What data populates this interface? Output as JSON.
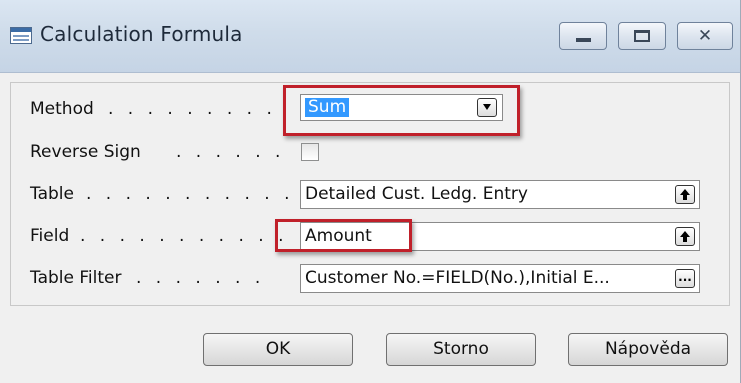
{
  "window": {
    "title": "Calculation Formula",
    "controls": {
      "minimize_glyph": "",
      "maximize_glyph": "",
      "close_glyph": "✕"
    }
  },
  "form": {
    "method": {
      "label": "Method",
      "dots": ". . . . . . . . .",
      "value": "Sum",
      "dropdown_icon": "chevron-down-icon"
    },
    "reverse_sign": {
      "label": "Reverse Sign",
      "dots": ". . . . . .",
      "checked": false
    },
    "table": {
      "label": "Table",
      "dots": ". . . . . . . . . . .",
      "value": "Detailed Cust. Ledg. Entry",
      "lookup_icon": "arrow-up-icon",
      "lookup_glyph": "🠅"
    },
    "field": {
      "label": "Field",
      "dots": ". . . . . . . . . . .",
      "value": "Amount",
      "lookup_icon": "arrow-up-icon",
      "lookup_glyph": "🠅"
    },
    "table_filter": {
      "label": "Table Filter",
      "dots": ". . . . . . .",
      "value": "Customer No.=FIELD(No.),Initial E...",
      "assist_icon": "ellipsis-icon",
      "assist_glyph": "..."
    }
  },
  "buttons": {
    "ok": "OK",
    "cancel": "Storno",
    "help": "Nápověda"
  },
  "colors": {
    "selection": "#3399ff",
    "highlight_annotation": "#c0202a"
  }
}
